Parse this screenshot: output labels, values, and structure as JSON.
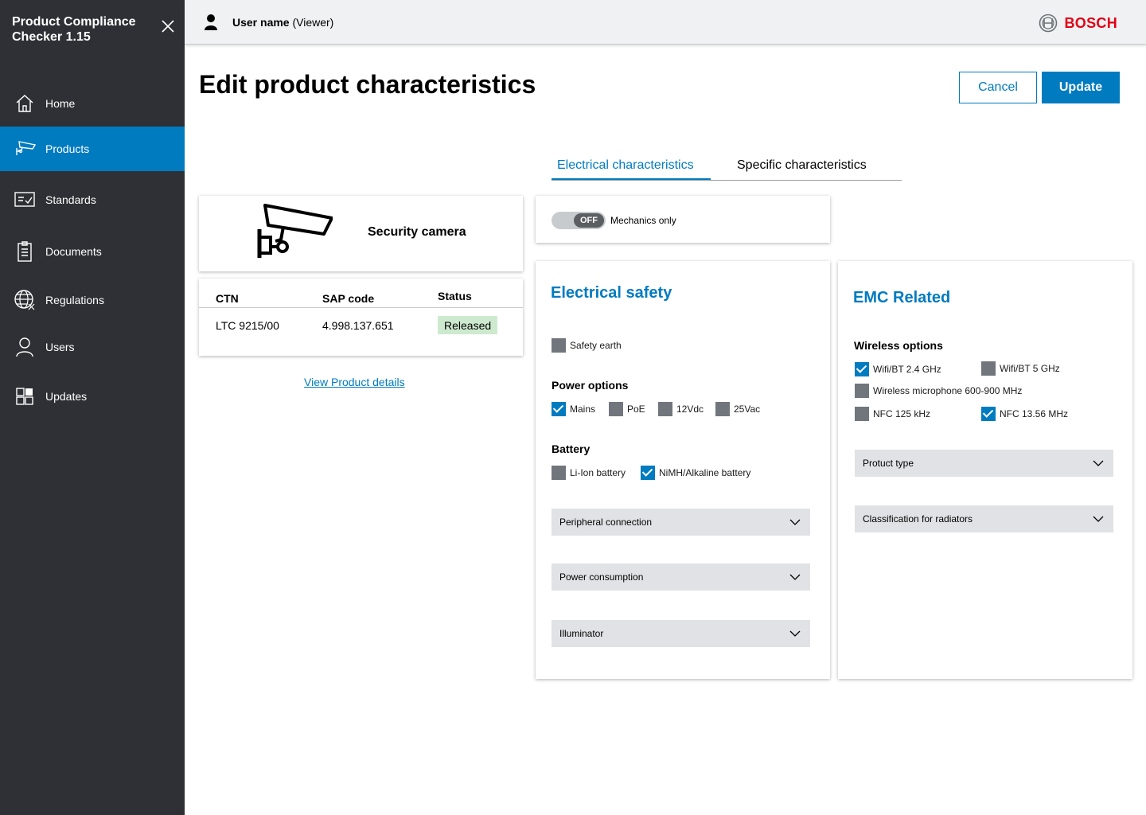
{
  "app": {
    "title": "Product Compliance Checker  1.15"
  },
  "nav": [
    {
      "label": "Home",
      "icon": "home-icon"
    },
    {
      "label": "Products",
      "icon": "camera-icon",
      "active": true
    },
    {
      "label": "Standards",
      "icon": "checklist-icon"
    },
    {
      "label": "Documents",
      "icon": "document-icon"
    },
    {
      "label": "Regulations",
      "icon": "globe-icon"
    },
    {
      "label": "Users",
      "icon": "user-icon"
    },
    {
      "label": "Updates",
      "icon": "grid-icon"
    }
  ],
  "header": {
    "user_name": "User name",
    "user_role": " (Viewer)",
    "brand": "BOSCH"
  },
  "page": {
    "title": "Edit product characteristics",
    "cancel_label": "Cancel",
    "update_label": "Update"
  },
  "tabs": [
    {
      "label": "Electrical characteristics",
      "active": true
    },
    {
      "label": "Specific characteristics",
      "active": false
    }
  ],
  "product": {
    "name": "Security camera"
  },
  "info": {
    "headers": [
      "CTN",
      "SAP code",
      "Status"
    ],
    "ctn": "LTC 9215/00",
    "sap": "4.998.137.651",
    "status": "Released",
    "link": "View Product details"
  },
  "toggle": {
    "state": "OFF",
    "label": "Mechanics only"
  },
  "electrical": {
    "title": "Electrical safety",
    "safety_earth": {
      "label": "Safety earth",
      "checked": false
    },
    "power_title": "Power options",
    "power": [
      {
        "label": "Mains",
        "checked": true
      },
      {
        "label": "PoE",
        "checked": false
      },
      {
        "label": "12Vdc",
        "checked": false
      },
      {
        "label": "25Vac",
        "checked": false
      }
    ],
    "battery_title": "Battery",
    "battery": [
      {
        "label": "Li-Ion battery",
        "checked": false
      },
      {
        "label": "NiMH/Alkaline battery",
        "checked": true
      }
    ],
    "dropdowns": [
      "Peripheral connection",
      "Power consumption",
      "Illuminator"
    ]
  },
  "emc": {
    "title": "EMC Related",
    "wireless_title": "Wireless options",
    "wireless": [
      {
        "label": "Wifi/BT 2.4 GHz",
        "checked": true
      },
      {
        "label": "Wifi/BT 5 GHz",
        "checked": false
      },
      {
        "label": "Wireless microphone 600-900 MHz",
        "checked": false
      },
      {
        "label": "NFC 125 kHz",
        "checked": false
      },
      {
        "label": "NFC 13.56 MHz",
        "checked": true
      }
    ],
    "dropdowns": [
      "Protuct type",
      "Classification for radiators"
    ]
  },
  "colors": {
    "accent": "#007bc0",
    "sidebar": "#2e3035",
    "brand_red": "#e20015",
    "badge_green": "#cdeacf"
  }
}
